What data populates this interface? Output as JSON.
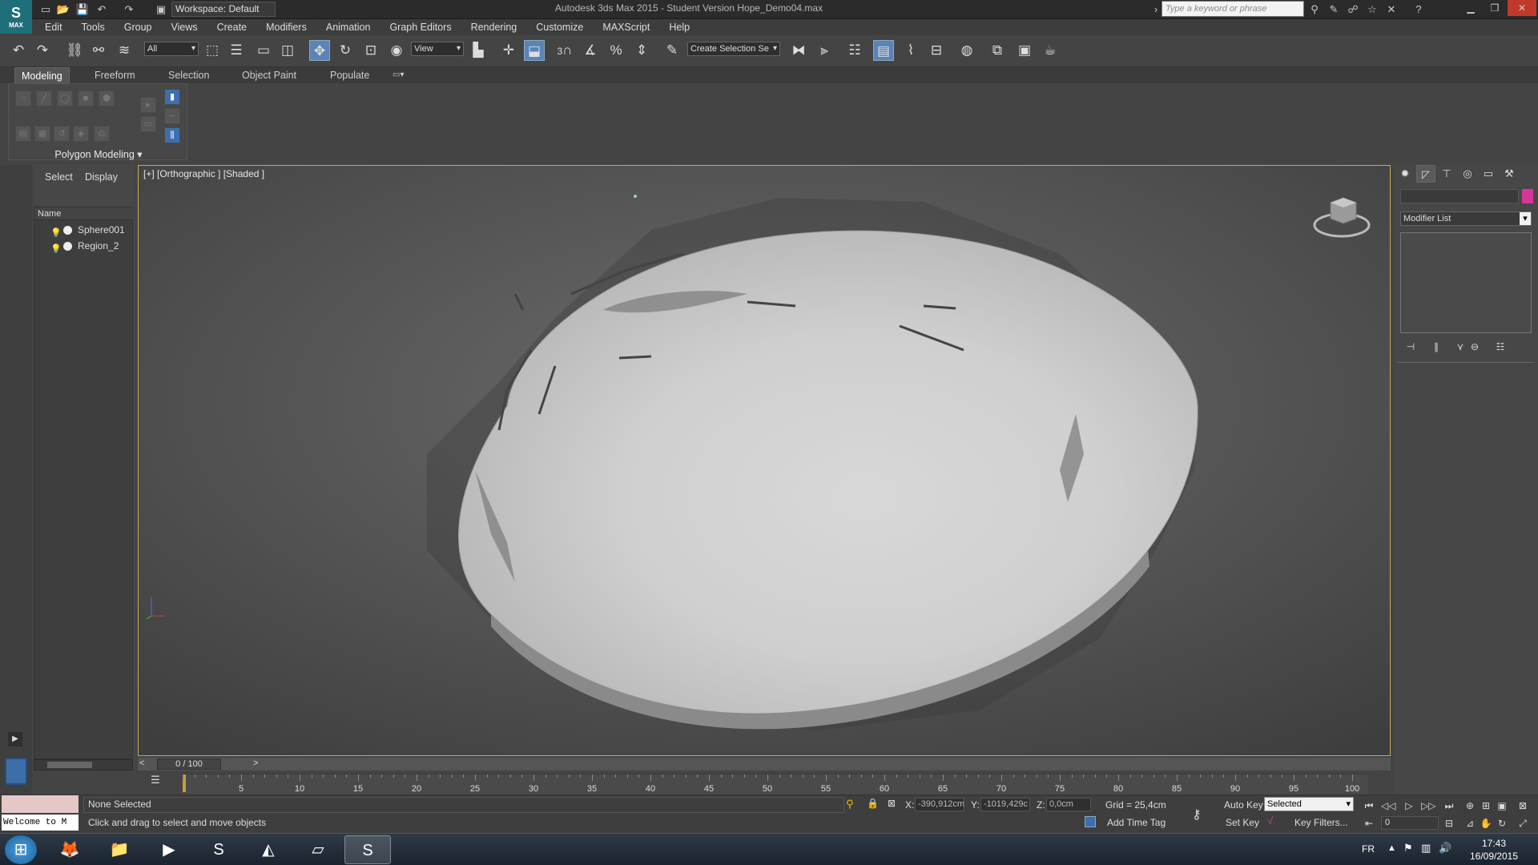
{
  "titlebar": {
    "workspace": "Workspace: Default",
    "window_title": "Autodesk 3ds Max 2015 - Student Version   Hope_Demo04.max",
    "search_placeholder": "Type a keyword or phrase",
    "logo": "MAX"
  },
  "menubar": {
    "items": [
      "Edit",
      "Tools",
      "Group",
      "Views",
      "Create",
      "Modifiers",
      "Animation",
      "Graph Editors",
      "Rendering",
      "Customize",
      "MAXScript",
      "Help"
    ]
  },
  "toolbar": {
    "selection_filter": "All",
    "ref_coord": "View",
    "named_selection": "Create Selection Se",
    "snap_angle_label": "3"
  },
  "ribbon": {
    "tabs": [
      "Modeling",
      "Freeform",
      "Selection",
      "Object Paint",
      "Populate"
    ],
    "panel_label": "Polygon Modeling"
  },
  "scene_explorer": {
    "tabs": [
      "Select",
      "Display"
    ],
    "column_header": "Name",
    "objects": [
      {
        "name": "Sphere001"
      },
      {
        "name": "Region_2"
      }
    ]
  },
  "viewport": {
    "label": "[+] [Orthographic ] [Shaded ]"
  },
  "timeline": {
    "frame_display": "0 / 100",
    "ticks": [
      "5",
      "10",
      "15",
      "20",
      "25",
      "30",
      "35",
      "40",
      "45",
      "50",
      "55",
      "60",
      "65",
      "70",
      "75",
      "80",
      "85",
      "90",
      "95",
      "100"
    ]
  },
  "status": {
    "maxscript_welcome": "Welcome to M",
    "selection_status": "None Selected",
    "prompt": "Click and drag to select and move objects",
    "x_label": "X:",
    "x_value": "-390,912cm",
    "y_label": "Y:",
    "y_value": "-1019,429c",
    "z_label": "Z:",
    "z_value": "0,0cm",
    "grid": "Grid = 25,4cm",
    "add_time_tag": "Add Time Tag",
    "auto_key": "Auto Key",
    "set_key": "Set Key",
    "key_mode": "Selected",
    "key_filters": "Key Filters...",
    "current_frame": "0"
  },
  "command_panel": {
    "modifier_list": "Modifier List",
    "object_color": "#d4379a"
  },
  "taskbar": {
    "language": "FR",
    "time": "17:43",
    "date": "16/09/2015"
  },
  "colors": {
    "viewport_border": "#c9ac4a",
    "active_button": "#5a83b8",
    "ribbon_active": "#3d6fb0"
  }
}
